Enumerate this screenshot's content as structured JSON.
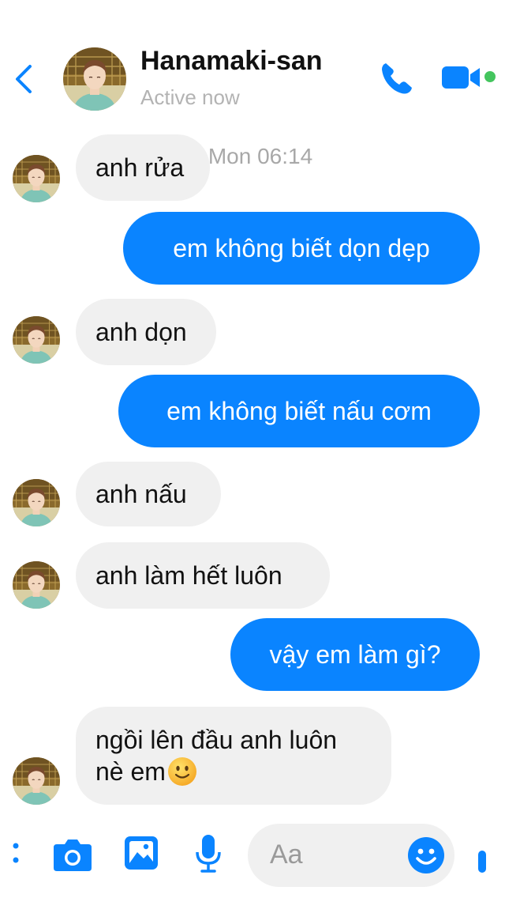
{
  "header": {
    "contact_name": "Hanamaki-san",
    "status": "Active now",
    "accent_color": "#0a84ff",
    "online_color": "#44c55e",
    "icons": [
      "back-chevron-icon",
      "phone-icon",
      "video-camera-icon"
    ]
  },
  "timestamp": "Mon 06:14",
  "messages": [
    {
      "direction": "incoming",
      "text": "anh rửa"
    },
    {
      "direction": "outgoing",
      "text": "em không biết dọn dẹp"
    },
    {
      "direction": "incoming",
      "text": "anh dọn"
    },
    {
      "direction": "outgoing",
      "text": "em không biết nấu cơm"
    },
    {
      "direction": "incoming",
      "text": "anh nấu"
    },
    {
      "direction": "incoming",
      "text": "anh làm hết luôn"
    },
    {
      "direction": "outgoing",
      "text": "vậy em làm gì?"
    },
    {
      "direction": "incoming",
      "text_line1": "ngồi lên đầu anh luôn",
      "text_line2": "nè em",
      "emoji": "slightly-smiling-face"
    }
  ],
  "composer": {
    "placeholder": "Aa",
    "tools": [
      "more-icon",
      "camera-icon",
      "photo-icon",
      "microphone-icon",
      "emoji-icon"
    ]
  }
}
